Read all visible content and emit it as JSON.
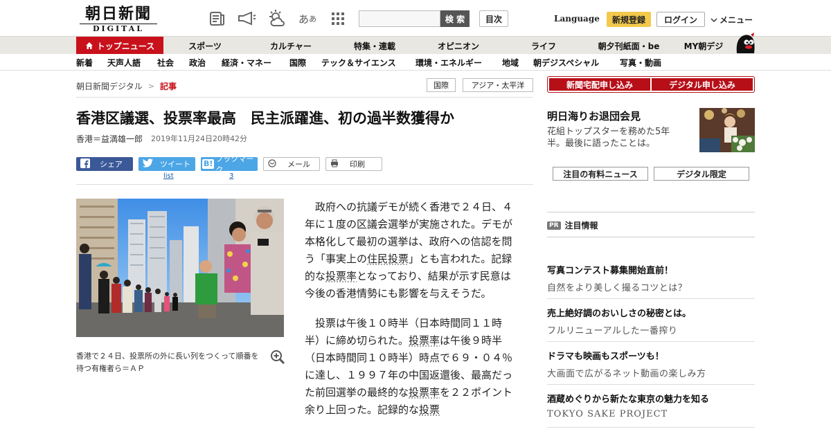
{
  "header": {
    "logo_jp": "朝日新聞",
    "logo_en": "DIGITAL",
    "search_button": "検 索",
    "toc_button": "目次",
    "language": "Language",
    "register": "新規登録",
    "login": "ログイン",
    "menu": "メニュー"
  },
  "nav_primary": [
    "トップニュース",
    "スポーツ",
    "カルチャー",
    "特集・連載",
    "オピニオン",
    "ライフ",
    "朝夕刊紙面・be",
    "MY朝デジ"
  ],
  "nav_secondary": [
    "新着",
    "天声人語",
    "社会",
    "政治",
    "経済・マネー",
    "国際",
    "テック＆サイエンス",
    "環境・エネルギー",
    "地域",
    "朝デジスペシャル",
    "写真・動画"
  ],
  "breadcrumb": {
    "site": "朝日新聞デジタル",
    "sep": ">",
    "current": "記事"
  },
  "tags": [
    "国際",
    "アジア・太平洋"
  ],
  "article": {
    "headline": "香港区議選、投票率最高　民主派躍進、初の過半数獲得か",
    "author": "香港＝益満雄一郎",
    "date": "2019年11月24日20時42分",
    "caption": "香港で２４日、投票所の外に長い列をつくって順番を待つ有権者ら＝ＡＰ",
    "p1_a": "政府への抗議デモが続く香港で２４日、４年に１度の区議会選挙が実施された。デモが本格化して最初の選挙は、政府への信認を問う「事実上の",
    "p1_kw1": "住民投票",
    "p1_b": "」とも言われた。記録的な",
    "p1_kw2": "投票率",
    "p1_c": "となっており、結果が示す民意は今後の香港情勢にも影響を与えそうだ。",
    "p2_a": "投票は午後１０時半（日本時間同１１時半）に締め切られた。",
    "p2_kw1": "投票率",
    "p2_b": "は午後９時半（日本時間同１０時半）時点で６９・０４％に達し、１９９７年の中国返還後、最高だった前回選挙の最終的な",
    "p2_kw2": "投票率",
    "p2_c": "を２２ポイント余り上回った。記録的な",
    "p2_kw3": "投票"
  },
  "share": {
    "facebook": "シェア",
    "twitter": "ツイート",
    "hatena": "ブックマーク",
    "mail": "メール",
    "print": "印刷",
    "twitter_count": "list",
    "hatena_count": "3"
  },
  "sidebar": {
    "sub_delivery": "新聞宅配申し込み",
    "sub_digital": "デジタル申し込み",
    "promo_title": "明日海りお退団会見",
    "promo_desc": "花組トップスターを務めた5年半。最後に語ったことは。",
    "pill_paid": "注目の有料ニュース",
    "pill_digital": "デジタル限定",
    "pr_badge": "PR",
    "pr_label": "注目情報",
    "ads": [
      {
        "title": "写真コンテスト募集開始直前！",
        "sub": "自然をより美しく撮るコツとは？"
      },
      {
        "title": "売上絶好調のおいしさの秘密とは。",
        "sub": "フルリニューアルした一番搾り"
      },
      {
        "title": "ドラマも映画もスポーツも！",
        "sub": "大画面で広がるネット動画の楽しみ方"
      },
      {
        "title": "酒蔵めぐりから新たな東京の魅力を知る",
        "sub": "TOKYO SAKE PROJECT"
      }
    ]
  },
  "colors": {
    "brand_red": "#c8111b",
    "register_yellow": "#f3c94c",
    "facebook": "#3b5998",
    "twitter": "#4ca6e6"
  }
}
